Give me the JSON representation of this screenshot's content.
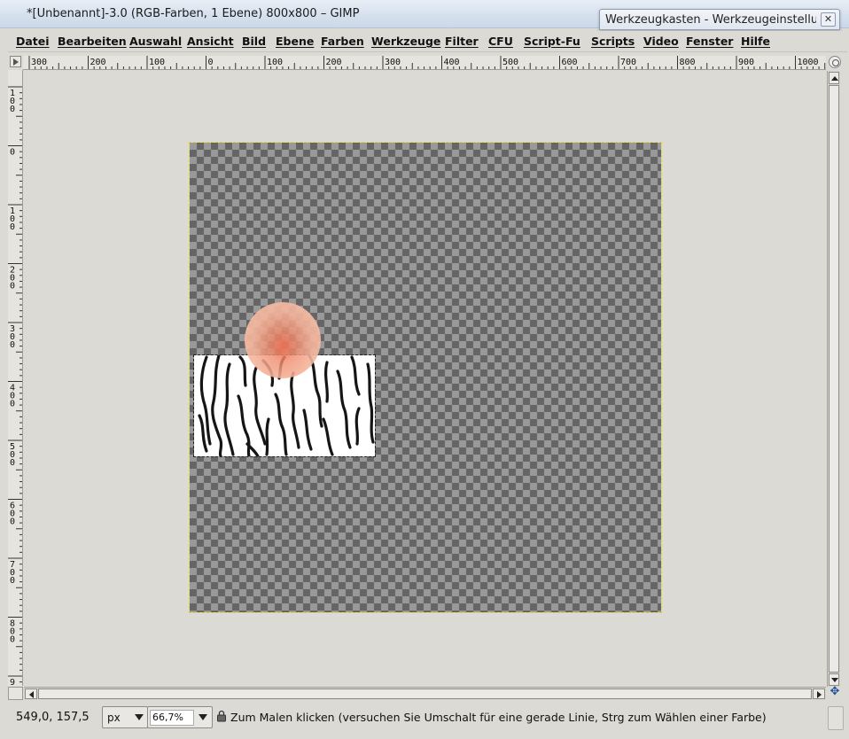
{
  "window": {
    "title": "*[Unbenannt]-3.0 (RGB-Farben, 1 Ebene) 800x800 – GIMP"
  },
  "other_window": {
    "title": "Werkzeugkasten - Werkzeugeinstellung...",
    "close_label": "✕"
  },
  "menu": [
    {
      "label": "Datei"
    },
    {
      "label": "Bearbeiten"
    },
    {
      "label": "Auswahl"
    },
    {
      "label": "Ansicht"
    },
    {
      "label": "Bild"
    },
    {
      "label": "Ebene"
    },
    {
      "label": "Farben"
    },
    {
      "label": "Werkzeuge"
    },
    {
      "label": "Filter"
    },
    {
      "label": "CFU"
    },
    {
      "label": "Script-Fu"
    },
    {
      "label": "Scripts"
    },
    {
      "label": "Video"
    },
    {
      "label": "Fenster"
    },
    {
      "label": "Hilfe"
    }
  ],
  "ruler": {
    "horizontal_labels": [
      "300",
      "200",
      "100",
      "0",
      "100",
      "200",
      "300",
      "400",
      "500",
      "600",
      "700",
      "800",
      "900",
      "1000"
    ],
    "vertical_labels": [
      "100",
      "0",
      "100",
      "200",
      "300",
      "400",
      "500",
      "600",
      "700",
      "800",
      "9"
    ]
  },
  "canvas": {
    "image_width": 800,
    "image_height": 800,
    "brush_color": "#ee7052",
    "selection_color": "#e8d630"
  },
  "status": {
    "coords": "549,0, 157,5",
    "unit": "px",
    "zoom": "66,7%",
    "message": "Zum Malen klicken (versuchen Sie Umschalt für eine gerade Linie, Strg zum Wählen einer Farbe)"
  }
}
